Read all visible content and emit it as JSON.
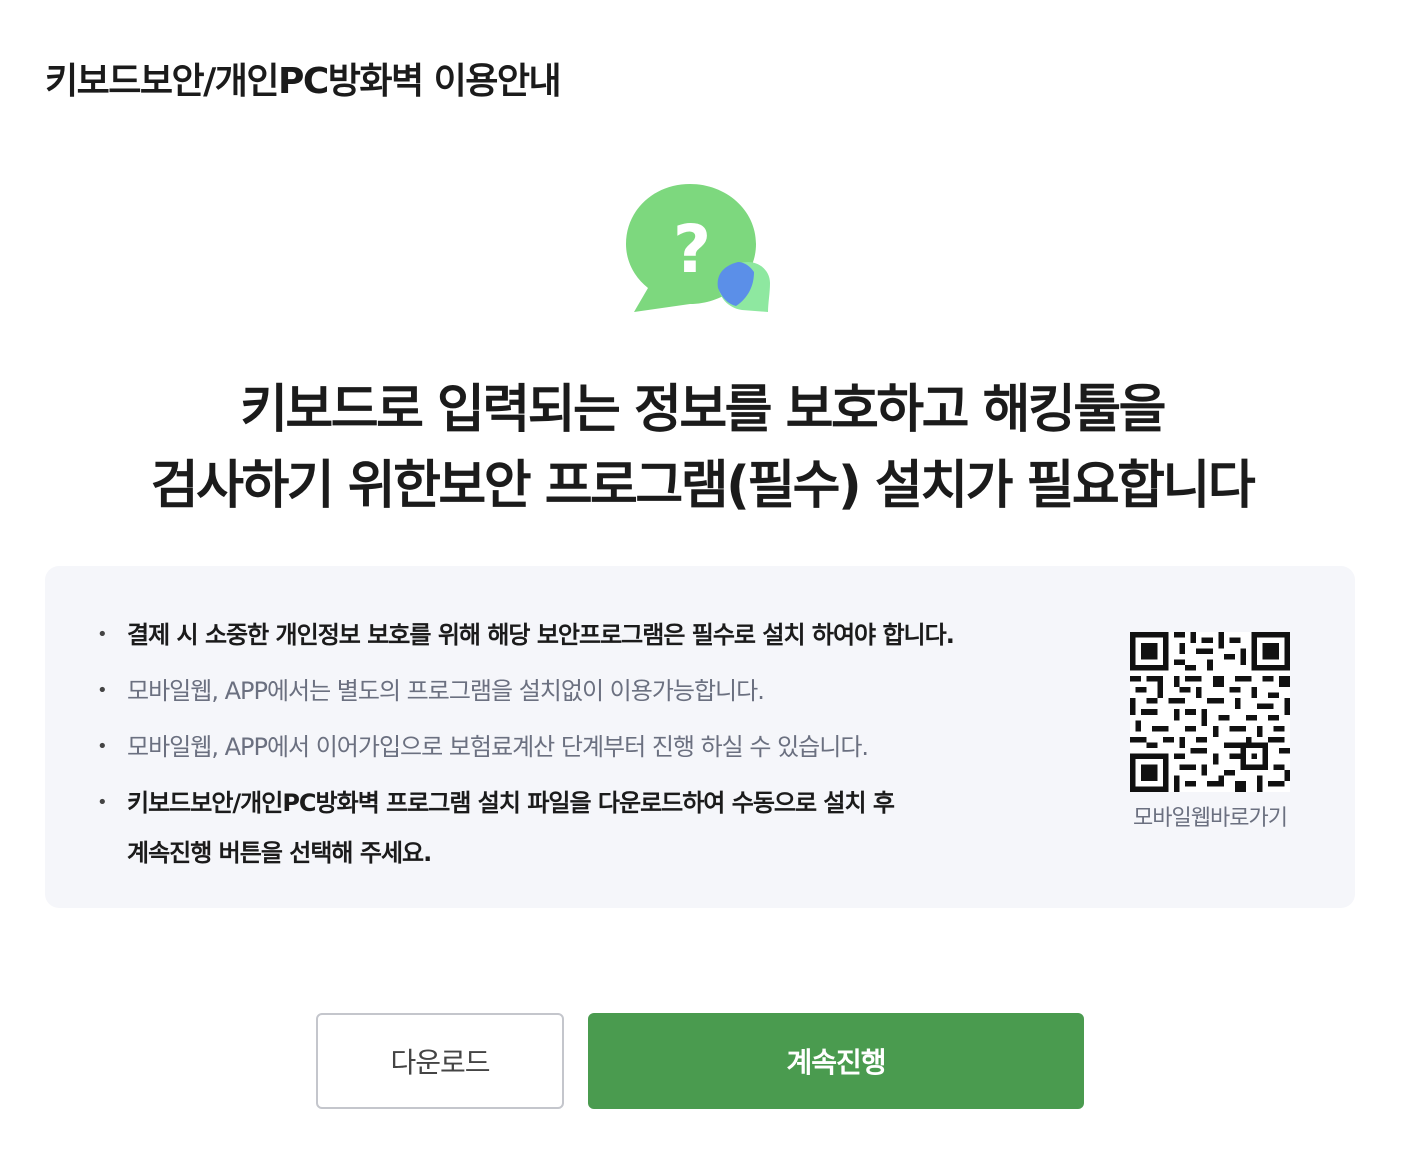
{
  "page": {
    "title": "키보드보안/개인PC방화벽 이용안내"
  },
  "headline": {
    "line1": "키보드로 입력되는 정보를 보호하고 해킹툴을",
    "line2": "검사하기 위한보안 프로그램(필수) 설치가 필요합니다"
  },
  "hero_icon": {
    "name": "question-chat-icon",
    "colors": {
      "bubble_main": "#7dd87e",
      "bubble_small": "#8ee8a0",
      "overlap": "#5b8fe8",
      "mark": "#ffffff"
    }
  },
  "notices": {
    "items": [
      {
        "text": "결제 시 소중한 개인정보 보호를 위해 해당 보안프로그램은 필수로 설치 하여야 합니다."
      },
      {
        "text": "모바일웹, APP에서는 별도의 프로그램을 설치없이 이용가능합니다."
      },
      {
        "text": "모바일웹, APP에서 이어가입으로 보험료계산 단계부터 진행 하실 수 있습니다."
      },
      {
        "line1": "키보드보안/개인PC방화벽 프로그램 설치 파일을 다운로드하여 수동으로 설치 후",
        "line2": "계속진행 버튼을 선택해 주세요."
      }
    ]
  },
  "qr": {
    "label": "모바일웹바로가기"
  },
  "actions": {
    "download_label": "다운로드",
    "continue_label": "계속진행"
  },
  "colors": {
    "primary": "#4a9b4f",
    "panel_bg": "#f5f6fa",
    "muted_text": "#6b7080"
  }
}
